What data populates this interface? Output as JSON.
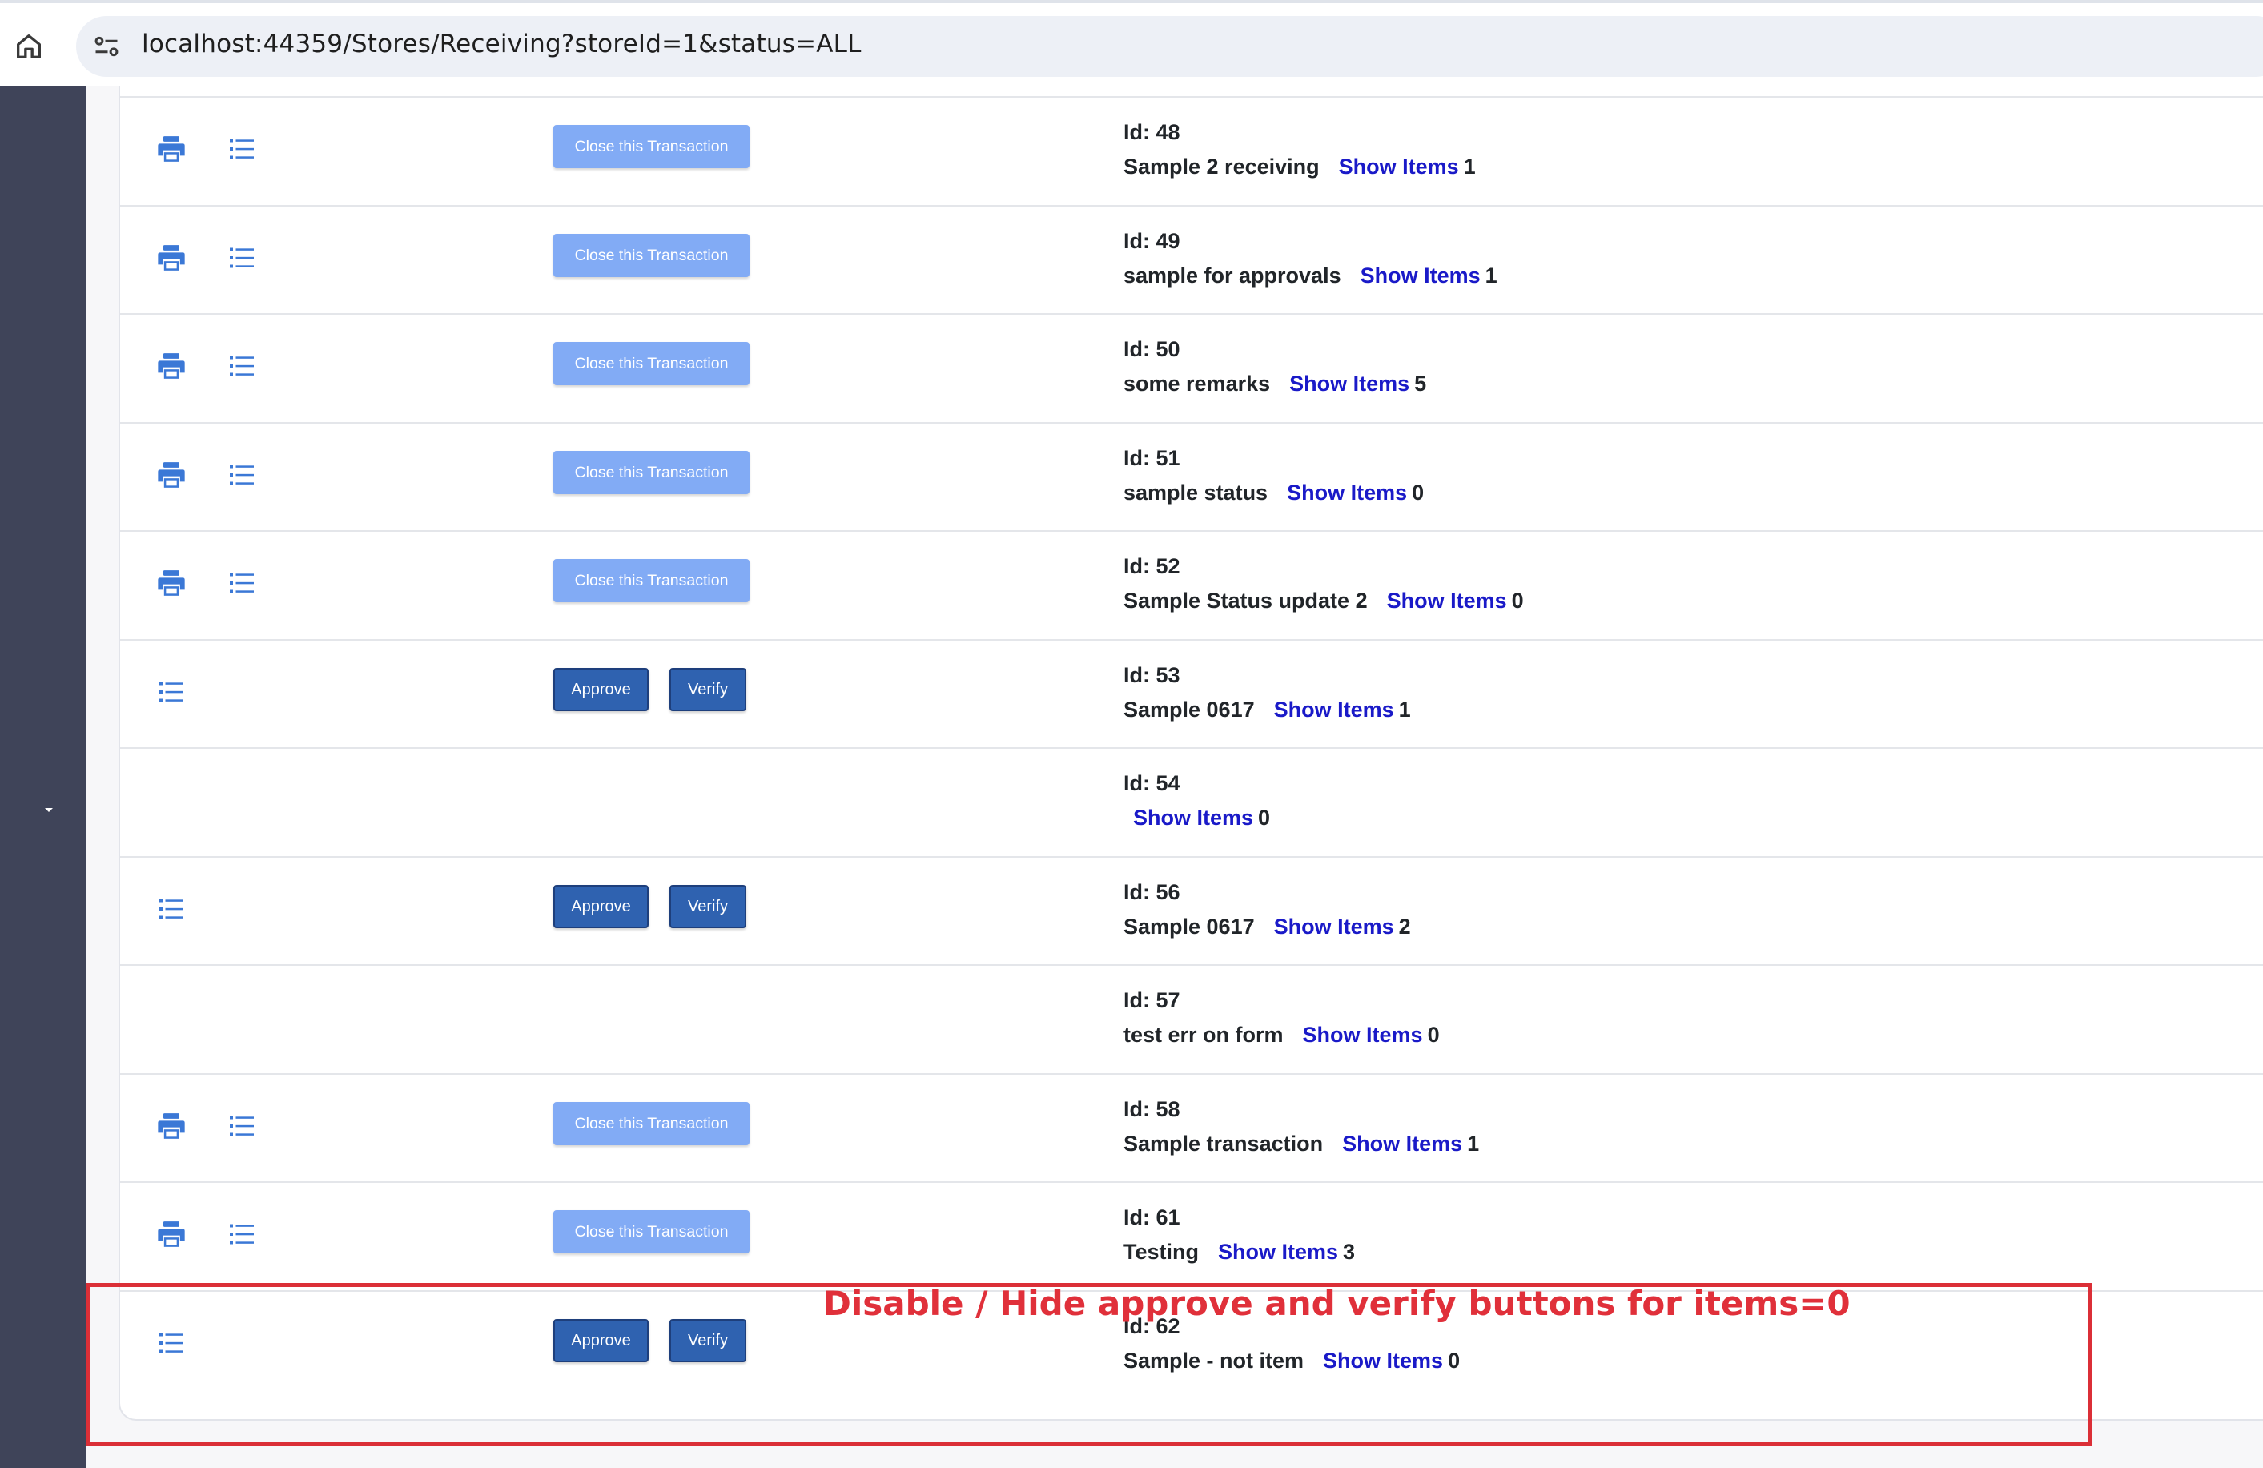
{
  "browser": {
    "url": "localhost:44359/Stores/Receiving?storeId=1&status=ALL"
  },
  "labels": {
    "close": "Close this Transaction",
    "approve": "Approve",
    "verify": "Verify",
    "show_items": "Show Items",
    "id_prefix": "Id:"
  },
  "rows": [
    {
      "id": "48",
      "remarks": "Sample 2 receiving",
      "items": "1",
      "actions": "close"
    },
    {
      "id": "49",
      "remarks": "sample for approvals",
      "items": "1",
      "actions": "close"
    },
    {
      "id": "50",
      "remarks": "some remarks",
      "items": "5",
      "actions": "close"
    },
    {
      "id": "51",
      "remarks": "sample status",
      "items": "0",
      "actions": "close"
    },
    {
      "id": "52",
      "remarks": "Sample Status update 2",
      "items": "0",
      "actions": "close"
    },
    {
      "id": "53",
      "remarks": "Sample 0617",
      "items": "1",
      "actions": "approve"
    },
    {
      "id": "54",
      "remarks": "",
      "items": "0",
      "actions": "none"
    },
    {
      "id": "56",
      "remarks": "Sample 0617",
      "items": "2",
      "actions": "approve"
    },
    {
      "id": "57",
      "remarks": "test err on form",
      "items": "0",
      "actions": "none"
    },
    {
      "id": "58",
      "remarks": "Sample transaction",
      "items": "1",
      "actions": "close"
    },
    {
      "id": "61",
      "remarks": "Testing",
      "items": "3",
      "actions": "close"
    },
    {
      "id": "62",
      "remarks": "Sample - not item",
      "items": "0",
      "actions": "approve"
    }
  ],
  "annotation": {
    "text": "Disable / Hide approve and verify buttons for items=0",
    "color": "#e0303a"
  },
  "colors": {
    "sidebar": "#3f4459",
    "primary_button": "#2f62b0",
    "disabled_button": "#82abf5",
    "link": "#1a1ac8",
    "icon": "#3b78d6"
  },
  "icons": {
    "row_print": "printer-icon",
    "row_list": "list-icon",
    "home": "home-icon",
    "site_info": "site-settings-icon",
    "sidebar_toggle": "caret-down-icon"
  }
}
